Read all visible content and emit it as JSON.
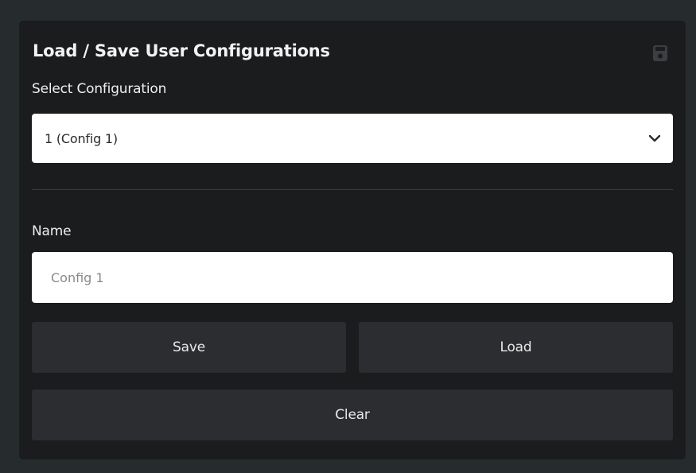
{
  "panel": {
    "title": "Load / Save User Configurations",
    "header_icon": "save-icon"
  },
  "select": {
    "label": "Select Configuration",
    "selected_value": "1 (Config 1)",
    "icon": "chevron-down-icon"
  },
  "name": {
    "label": "Name",
    "value": "",
    "placeholder": "Config 1"
  },
  "buttons": {
    "save_label": "Save",
    "load_label": "Load",
    "clear_label": "Clear"
  },
  "colors": {
    "page_background": "#262b2e",
    "panel_background": "#1b1c1e",
    "button_background": "#2b2d30",
    "input_background": "#ffffff",
    "icon_color": "#3c3e41"
  }
}
